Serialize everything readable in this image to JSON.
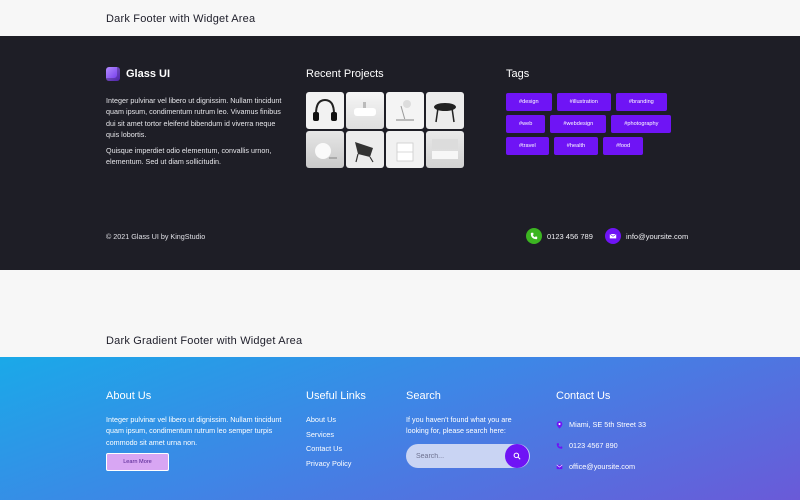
{
  "sections": {
    "dark_title": "Dark Footer with Widget Area",
    "gradient_title": "Dark Gradient Footer with Widget Area"
  },
  "dark_footer": {
    "brand": "Glass UI",
    "about": [
      "Integer pulvinar vel libero ut dignissim. Nullam tincidunt quam ipsum, condimentum rutrum leo. Vivamus finibus dui sit amet tortor eleifend bibendum id viverra neque quis lobortis.",
      "Quisque imperdiet odio elementum, convallis urnon, elementum. Sed ut diam sollicitudin."
    ],
    "projects_title": "Recent Projects",
    "projects": [
      "headphones",
      "washbasin",
      "desk-lamp",
      "coffee-table",
      "round-lamp",
      "lounge-chair",
      "display-cabinet",
      "modern-bathroom"
    ],
    "tags_title": "Tags",
    "tags": [
      "#design",
      "#illustration",
      "#branding",
      "#web",
      "#webdesign",
      "#photography",
      "#travel",
      "#health",
      "#food"
    ],
    "copyright": "© 2021 Glass UI by KingStudio",
    "phone": "0123 456 789",
    "email": "info@yoursite.com",
    "colors": {
      "background": "#1e1e26",
      "accent": "#6f14f5",
      "phone_icon": "#3cb521"
    }
  },
  "gradient_footer": {
    "about_title": "About Us",
    "about_text": "Integer pulvinar vel libero ut dignissim. Nullam tincidunt quam ipsum, condimentum rutrum leo semper turpis commodo sit amet urna non.",
    "learn_more": "Learn More",
    "links_title": "Useful Links",
    "links": [
      "About Us",
      "Services",
      "Contact Us",
      "Privacy Policy"
    ],
    "search_title": "Search",
    "search_desc": "If you haven't found what you are looking for, please search here:",
    "search_placeholder": "Search...",
    "contact_title": "Contact Us",
    "address": "Miami, SE 5th Street 33",
    "phone": "0123 4567 890",
    "email": "office@yoursite.com",
    "colors": {
      "gradient_start": "#1aa9e8",
      "gradient_end": "#6a5ad8"
    }
  }
}
